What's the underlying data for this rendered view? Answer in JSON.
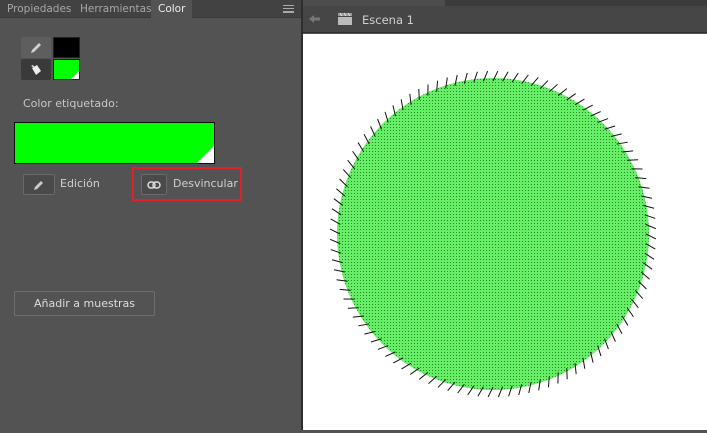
{
  "panel": {
    "tabs": [
      {
        "label": "Propiedades"
      },
      {
        "label": "Herramientas"
      },
      {
        "label": "Color"
      }
    ],
    "active_tab": "Color",
    "stroke_color": "#000000",
    "fill_color": "#00ff00",
    "labeled_color_label": "Color etiquetado:",
    "edit_label": "Edición",
    "unlink_label": "Desvincular",
    "add_swatch_label": "Añadir a muestras"
  },
  "scene": {
    "title": "Escena 1"
  },
  "stage": {
    "shape_fill": "#66ee66"
  }
}
